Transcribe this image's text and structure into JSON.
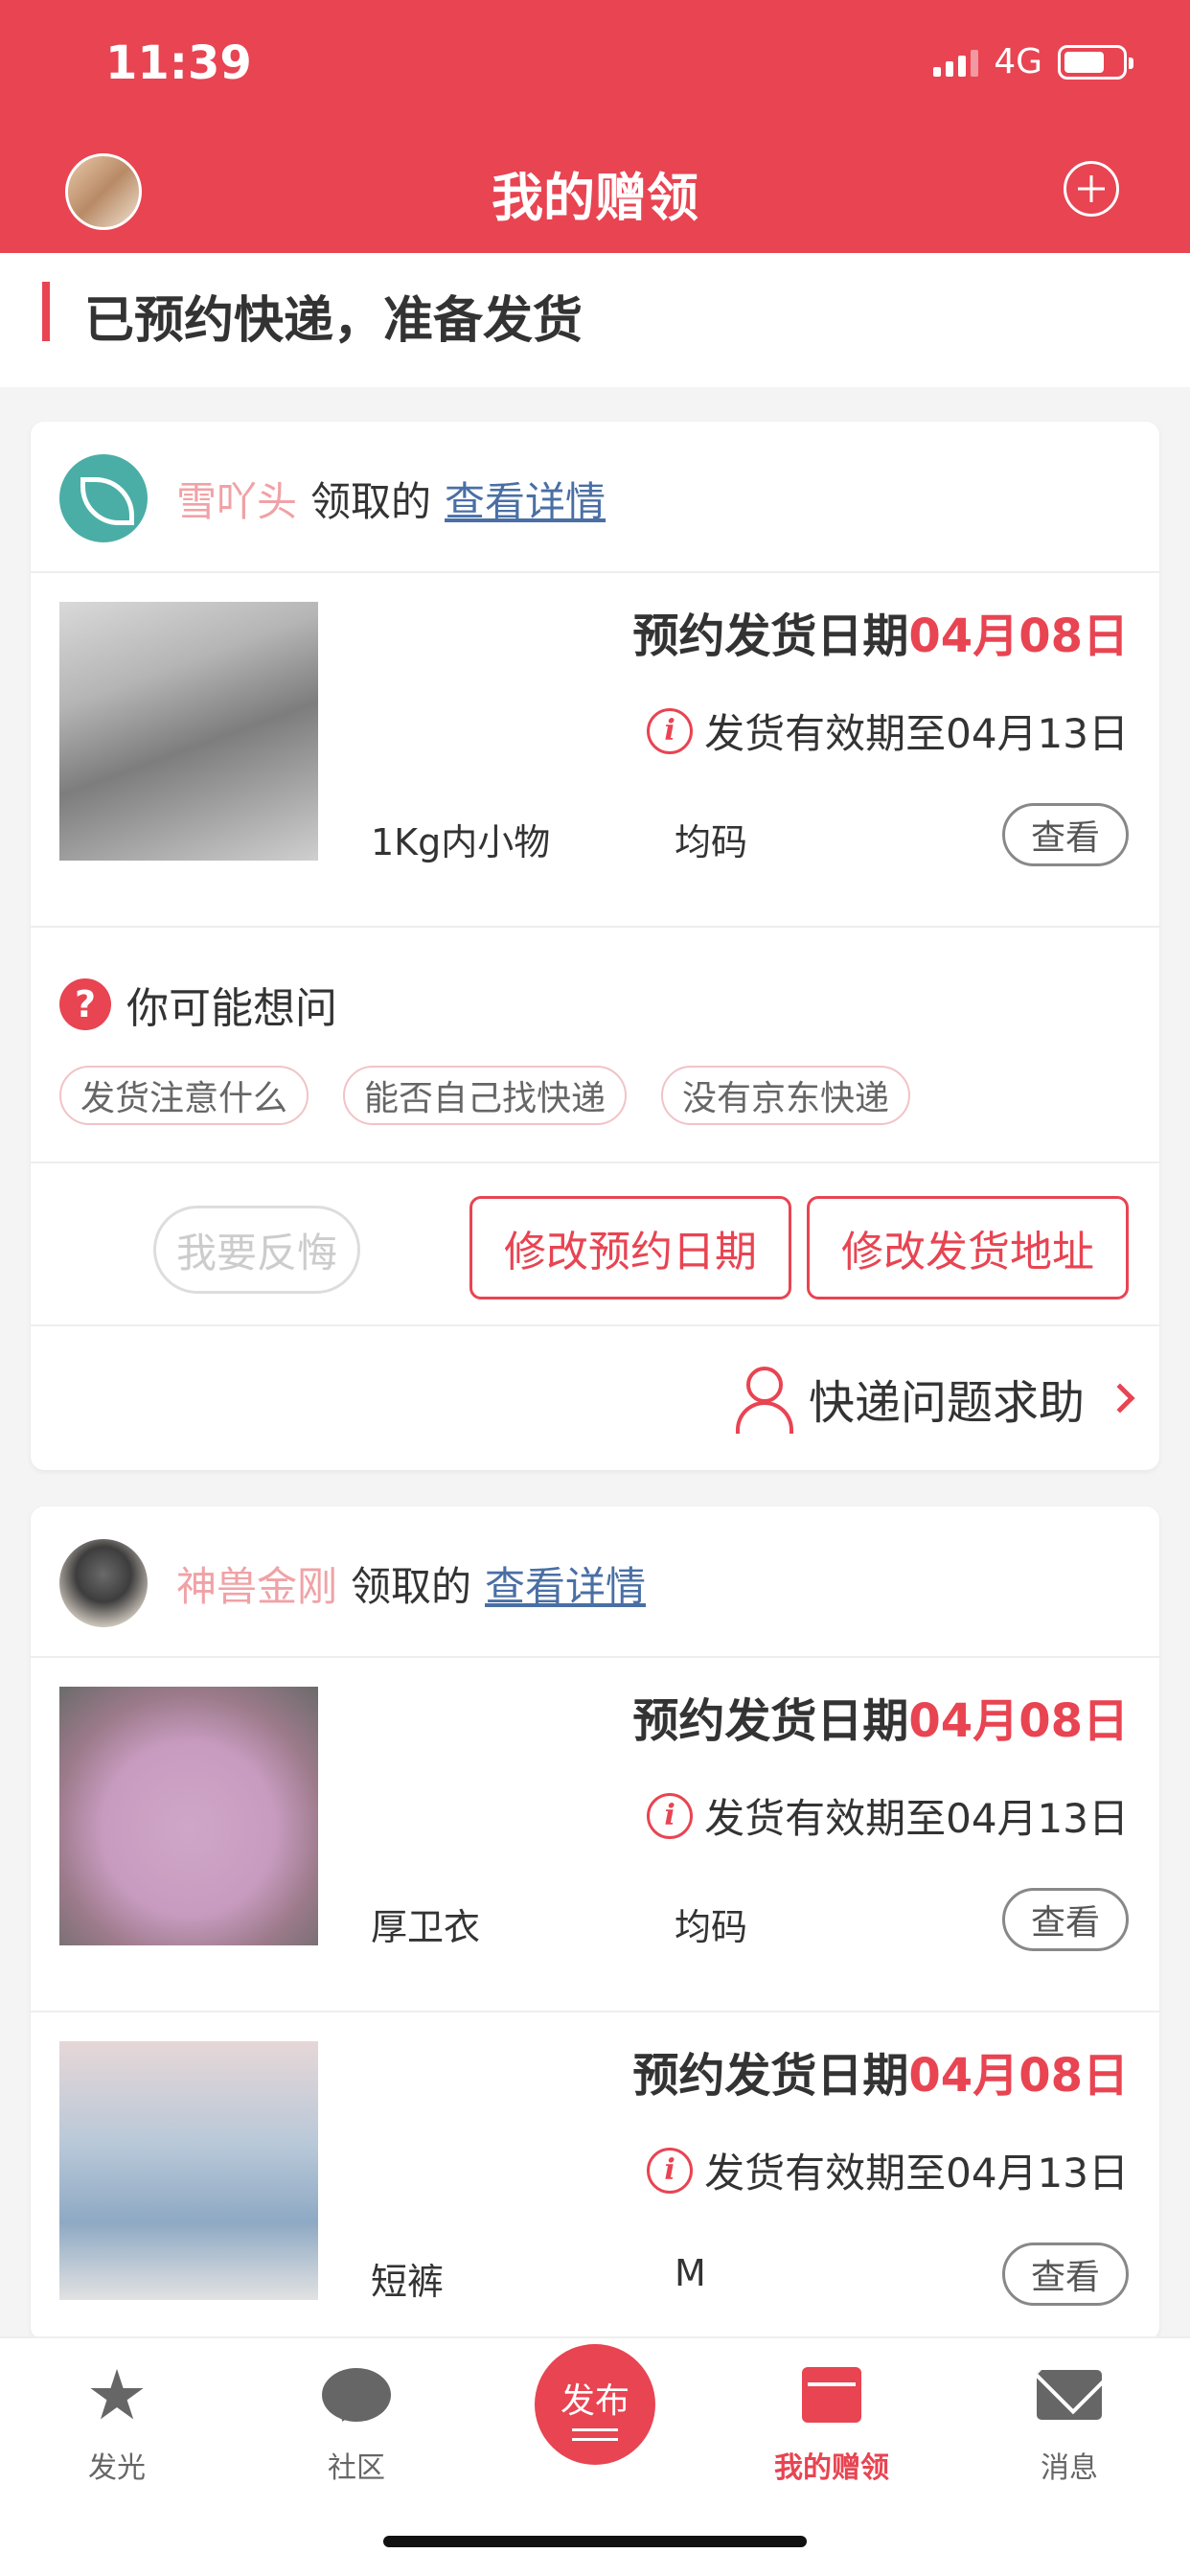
{
  "status_bar": {
    "time": "11:39",
    "network": "4G"
  },
  "header": {
    "title": "我的赠领"
  },
  "section": {
    "title": "已预约快递，准备发货"
  },
  "cards": [
    {
      "user": {
        "name": "雪吖头",
        "verb": "领取的",
        "link": "查看详情"
      },
      "items": [
        {
          "ship_label": "预约发货日期",
          "ship_date": "04月08日",
          "valid": "发货有效期至04月13日",
          "desc": "1Kg内小物",
          "size": "均码",
          "view": "查看"
        }
      ],
      "faq": {
        "title": "你可能想问",
        "tags": [
          "发货注意什么",
          "能否自己找快递",
          "没有京东快递"
        ]
      },
      "actions": {
        "regret": "我要反悔",
        "change_date": "修改预约日期",
        "change_address": "修改发货地址"
      },
      "help": "快递问题求助"
    },
    {
      "user": {
        "name": "神兽金刚",
        "verb": "领取的",
        "link": "查看详情"
      },
      "items": [
        {
          "ship_label": "预约发货日期",
          "ship_date": "04月08日",
          "valid": "发货有效期至04月13日",
          "desc": "厚卫衣",
          "size": "均码",
          "view": "查看"
        },
        {
          "ship_label": "预约发货日期",
          "ship_date": "04月08日",
          "valid": "发货有效期至04月13日",
          "desc": "短裤",
          "size": "M",
          "view": "查看"
        }
      ]
    }
  ],
  "tabbar": {
    "tabs": [
      {
        "label": "发光",
        "icon": "star-icon"
      },
      {
        "label": "社区",
        "icon": "chat-icon"
      },
      {
        "label": "我的赠领",
        "icon": "gift-icon",
        "active": true
      },
      {
        "label": "消息",
        "icon": "mail-icon"
      }
    ],
    "publish": "发布"
  },
  "colors": {
    "accent": "#e84452",
    "link": "#4a6fa5",
    "username": "#f0a2a6"
  }
}
